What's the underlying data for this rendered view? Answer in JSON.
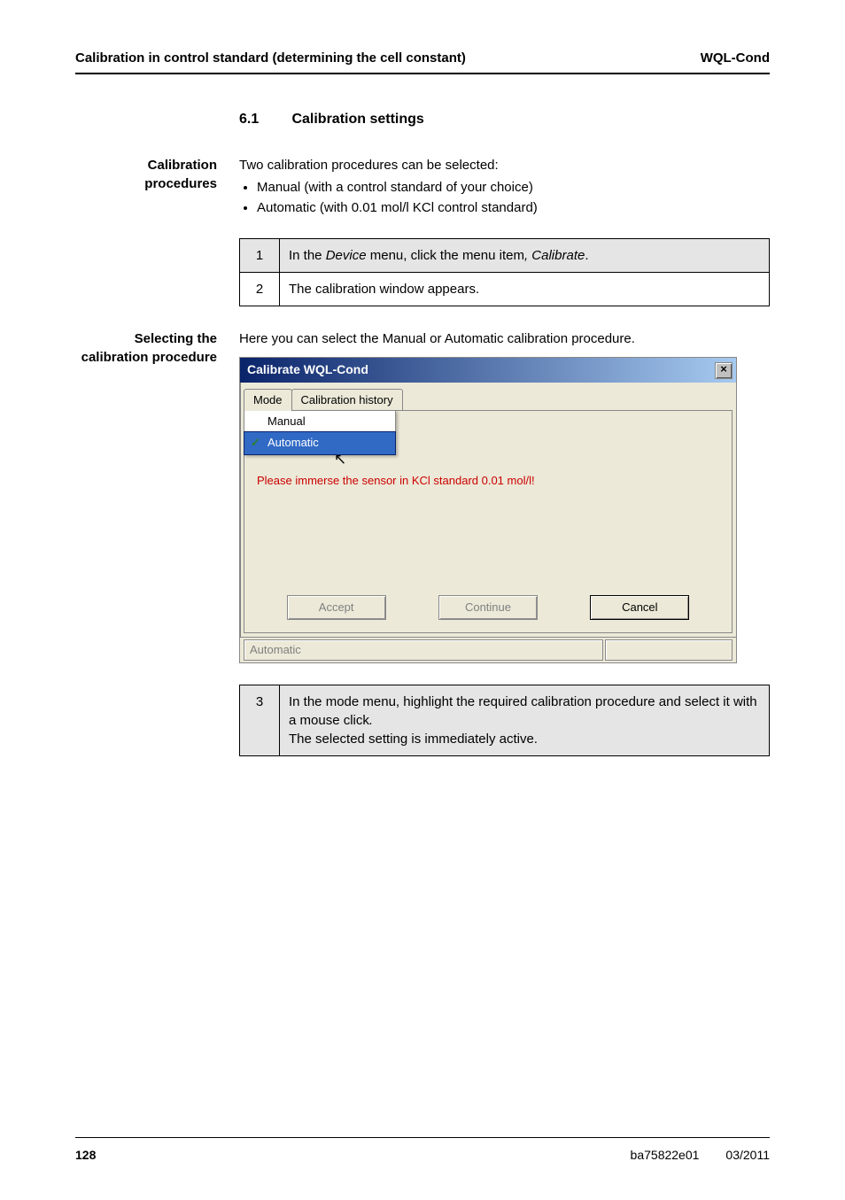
{
  "header": {
    "left": "Calibration in control standard (determining the cell constant)",
    "right": "WQL-Cond"
  },
  "section": {
    "num": "6.1",
    "title": "Calibration settings"
  },
  "sidehead1": "Calibration procedures",
  "intro1": "Two calibration procedures can be selected:",
  "bullets1": [
    "Manual (with a control standard of your choice)",
    "Automatic (with 0.01 mol/l KCl control standard)"
  ],
  "steps1": [
    {
      "n": "1",
      "prefix": "In the ",
      "ital1": "Device",
      "mid": " menu, click the menu item",
      "ital2": ", Calibrate",
      "end": "."
    },
    {
      "n": "2",
      "plain": "The calibration window appears."
    }
  ],
  "sidehead2": "Selecting the calibration procedure",
  "intro2": "Here you can select the Manual or Automatic calibration procedure.",
  "dialog": {
    "title": "Calibrate WQL-Cond",
    "close": "×",
    "tabs": [
      "Mode",
      "Calibration history"
    ],
    "menu": {
      "items": [
        "Manual",
        "Automatic"
      ],
      "highlighted": 1,
      "checked": 1
    },
    "panelText": "Please immerse the sensor in KCl standard 0.01 mol/l!",
    "buttons": {
      "accept": "Accept",
      "continue": "Continue",
      "cancel": "Cancel"
    },
    "status": "Automatic"
  },
  "steps2": [
    {
      "n": "3",
      "line1": "In the mode menu, highlight the required calibration procedure and select it with a mouse click",
      "ital": ".",
      "line2": "The selected setting is immediately active."
    }
  ],
  "footer": {
    "page": "128",
    "doc": "ba75822e01",
    "date": "03/2011"
  }
}
